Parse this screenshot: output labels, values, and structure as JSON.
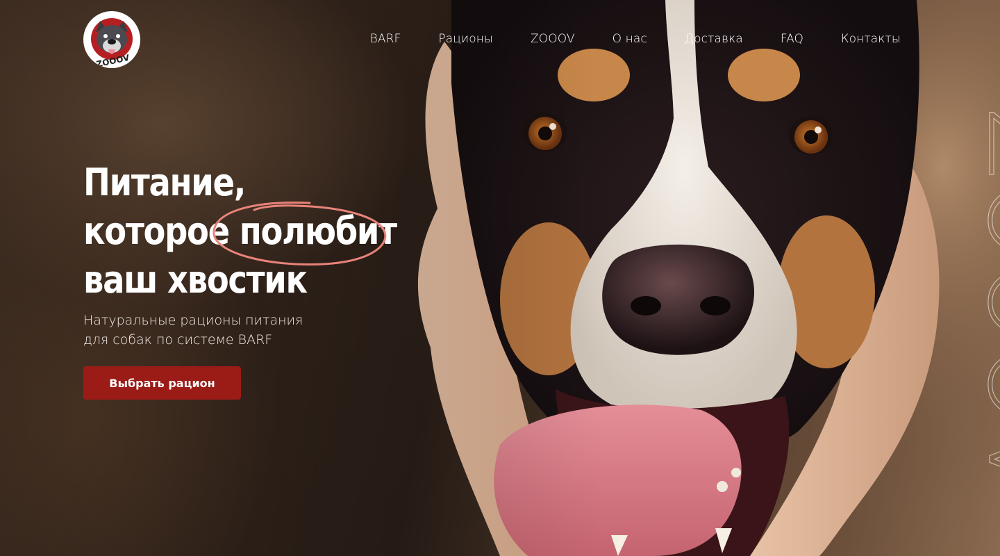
{
  "brand": {
    "logo_text": "ZOOOV"
  },
  "nav": {
    "items": [
      {
        "label": "BARF"
      },
      {
        "label": "Рационы"
      },
      {
        "label": "ZOOOV"
      },
      {
        "label": "О нас"
      },
      {
        "label": "Доставка"
      },
      {
        "label": "FAQ"
      },
      {
        "label": "Контакты"
      }
    ]
  },
  "hero": {
    "headline_line1": "Питание,",
    "headline_line2_a": "которое ",
    "headline_line2_b": "полюбит",
    "headline_line3": "ваш хвостик",
    "subtitle_line1": "Натуральные рационы питания",
    "subtitle_line2": "для собак по системе BARF",
    "cta_label": "Выбрать рацион",
    "watermark_text": "ZOOOV"
  },
  "colors": {
    "accent": "#9b1b17",
    "highlight_circle": "#e8837a",
    "text": "#ffffff"
  },
  "icons": {
    "logo": "dog-face-logo-icon"
  }
}
